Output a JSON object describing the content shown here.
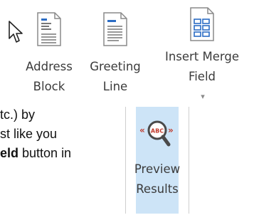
{
  "ribbon": {
    "address_block": {
      "line1": "Address",
      "line2": "Block",
      "icon": "address-block-icon"
    },
    "greeting_line": {
      "line1": "Greeting",
      "line2": "Line",
      "icon": "greeting-line-icon"
    },
    "insert_merge_field": {
      "line1": "Insert Merge",
      "line2": "Field",
      "caret": "▾",
      "icon": "insert-merge-field-icon"
    }
  },
  "document": {
    "line1": "tc.) by",
    "line2": "st like you",
    "line3_bold": "eld",
    "line3_rest": " button in"
  },
  "preview_results": {
    "line1": "Preview",
    "line2": "Results",
    "icon": "preview-results-icon",
    "badge_text": "ABC",
    "highlight_color": "#cde4f7",
    "accent_color": "#c0392b",
    "lens_color": "#4a4a4a"
  },
  "colors": {
    "icon_blue": "#2b6cc4",
    "icon_border": "#8a8a8a"
  }
}
